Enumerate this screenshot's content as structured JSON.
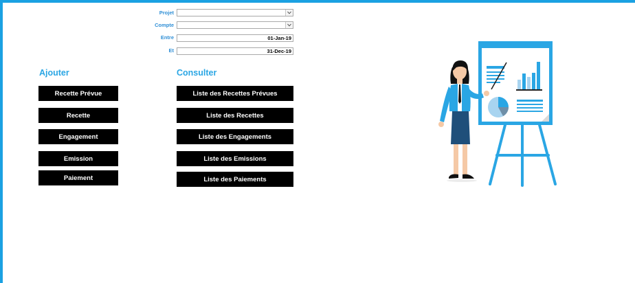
{
  "filters": {
    "projet": {
      "label": "Projet",
      "value": ""
    },
    "compte": {
      "label": "Compte",
      "value": ""
    },
    "entre": {
      "label": "Entre",
      "value": "01-Jan-19"
    },
    "et": {
      "label": "Et",
      "value": "31-Dec-19"
    }
  },
  "ajouter": {
    "title": "Ajouter",
    "buttons": [
      "Recette Prévue",
      "Recette",
      "Engagement",
      "Emission",
      "Paiement"
    ]
  },
  "consulter": {
    "title": "Consulter",
    "buttons": [
      "Liste des Recettes Prévues",
      "Liste des Recettes",
      "Liste des Engagements",
      "Liste des Emissions",
      "Liste des Paiements"
    ]
  },
  "illustration": {
    "icon": "presenter-with-chart-board-icon"
  },
  "colors": {
    "accent": "#1ba1e2",
    "label": "#2f8fd6",
    "button": "#000000"
  }
}
